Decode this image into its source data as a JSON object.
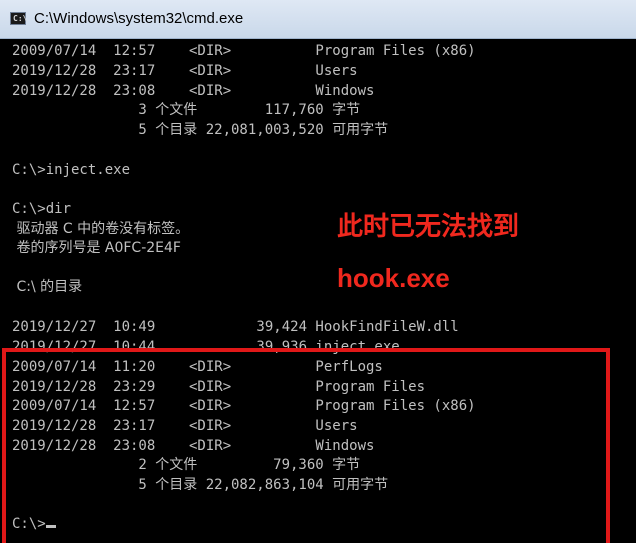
{
  "window": {
    "title": "C:\\Windows\\system32\\cmd.exe",
    "icon": "cmd-icon",
    "icon_text": "C:\\"
  },
  "lines": [
    "2009/07/14  12:57    <DIR>          Program Files (x86)",
    "2019/12/28  23:17    <DIR>          Users",
    "2019/12/28  23:08    <DIR>          Windows",
    "               3 个文件        117,760 字节",
    "               5 个目录 22,081,003,520 可用字节",
    "",
    "C:\\>inject.exe",
    "",
    "C:\\>dir",
    " 驱动器 C 中的卷没有标签。",
    " 卷的序列号是 A0FC-2E4F",
    "",
    " C:\\ 的目录",
    "",
    "2019/12/27  10:49            39,424 HookFindFileW.dll",
    "2019/12/27  10:44            39,936 inject.exe",
    "2009/07/14  11:20    <DIR>          PerfLogs",
    "2019/12/28  23:29    <DIR>          Program Files",
    "2009/07/14  12:57    <DIR>          Program Files (x86)",
    "2019/12/28  23:17    <DIR>          Users",
    "2019/12/28  23:08    <DIR>          Windows",
    "               2 个文件         79,360 字节",
    "               5 个目录 22,082,863,104 可用字节",
    "",
    "C:\\>"
  ],
  "annotation": {
    "line1": "此时已无法找到",
    "line2": "hook.exe",
    "color": "#f0281e"
  },
  "colors": {
    "console_bg": "#000000",
    "console_text": "#c0c0c0",
    "box": "#e01818"
  }
}
